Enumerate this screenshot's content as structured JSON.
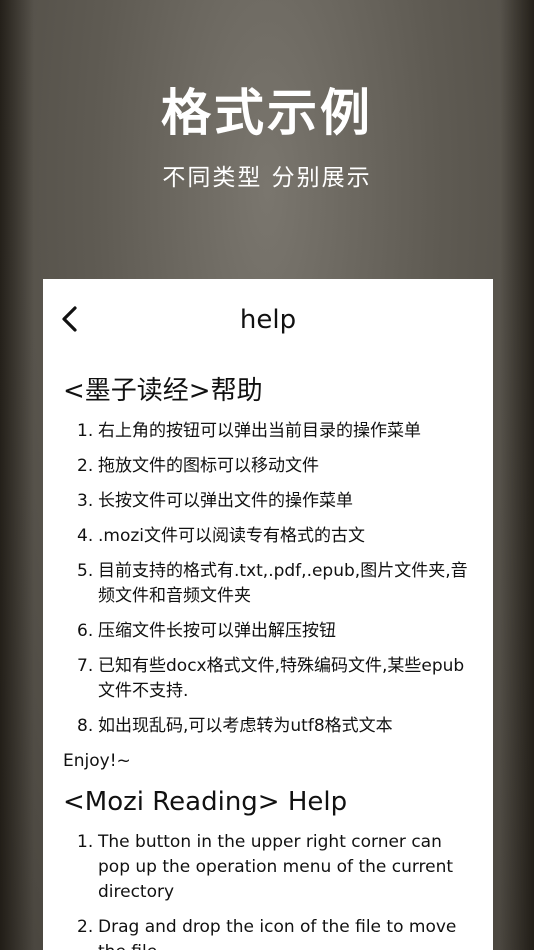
{
  "hero": {
    "title": "格式示例",
    "subtitle": "不同类型 分别展示"
  },
  "nav": {
    "title": "help",
    "back_icon": "chevron-left-icon"
  },
  "help_zh": {
    "heading": "<墨子读经>帮助",
    "items": [
      {
        "num": "1.",
        "text": "右上角的按钮可以弹出当前目录的操作菜单"
      },
      {
        "num": "2.",
        "text": "拖放文件的图标可以移动文件"
      },
      {
        "num": "3.",
        "text": "长按文件可以弹出文件的操作菜单"
      },
      {
        "num": "4.",
        "text": ".mozi文件可以阅读专有格式的古文"
      },
      {
        "num": "5.",
        "text": "目前支持的格式有.txt,.pdf,.epub,图片文件夹,音频文件和音频文件夹"
      },
      {
        "num": "6.",
        "text": "压缩文件长按可以弹出解压按钮"
      },
      {
        "num": "7.",
        "text": "已知有些docx格式文件,特殊编码文件,某些epub文件不支持."
      },
      {
        "num": "8.",
        "text": "如出现乱码,可以考虑转为utf8格式文本"
      }
    ],
    "closing": "Enjoy!~"
  },
  "help_en": {
    "heading": "<Mozi Reading> Help",
    "items": [
      {
        "num": "1.",
        "text": "The button in the upper right corner can pop up the operation menu of the current directory"
      },
      {
        "num": "2.",
        "text": "Drag and drop the icon of the file to move the file"
      }
    ]
  }
}
